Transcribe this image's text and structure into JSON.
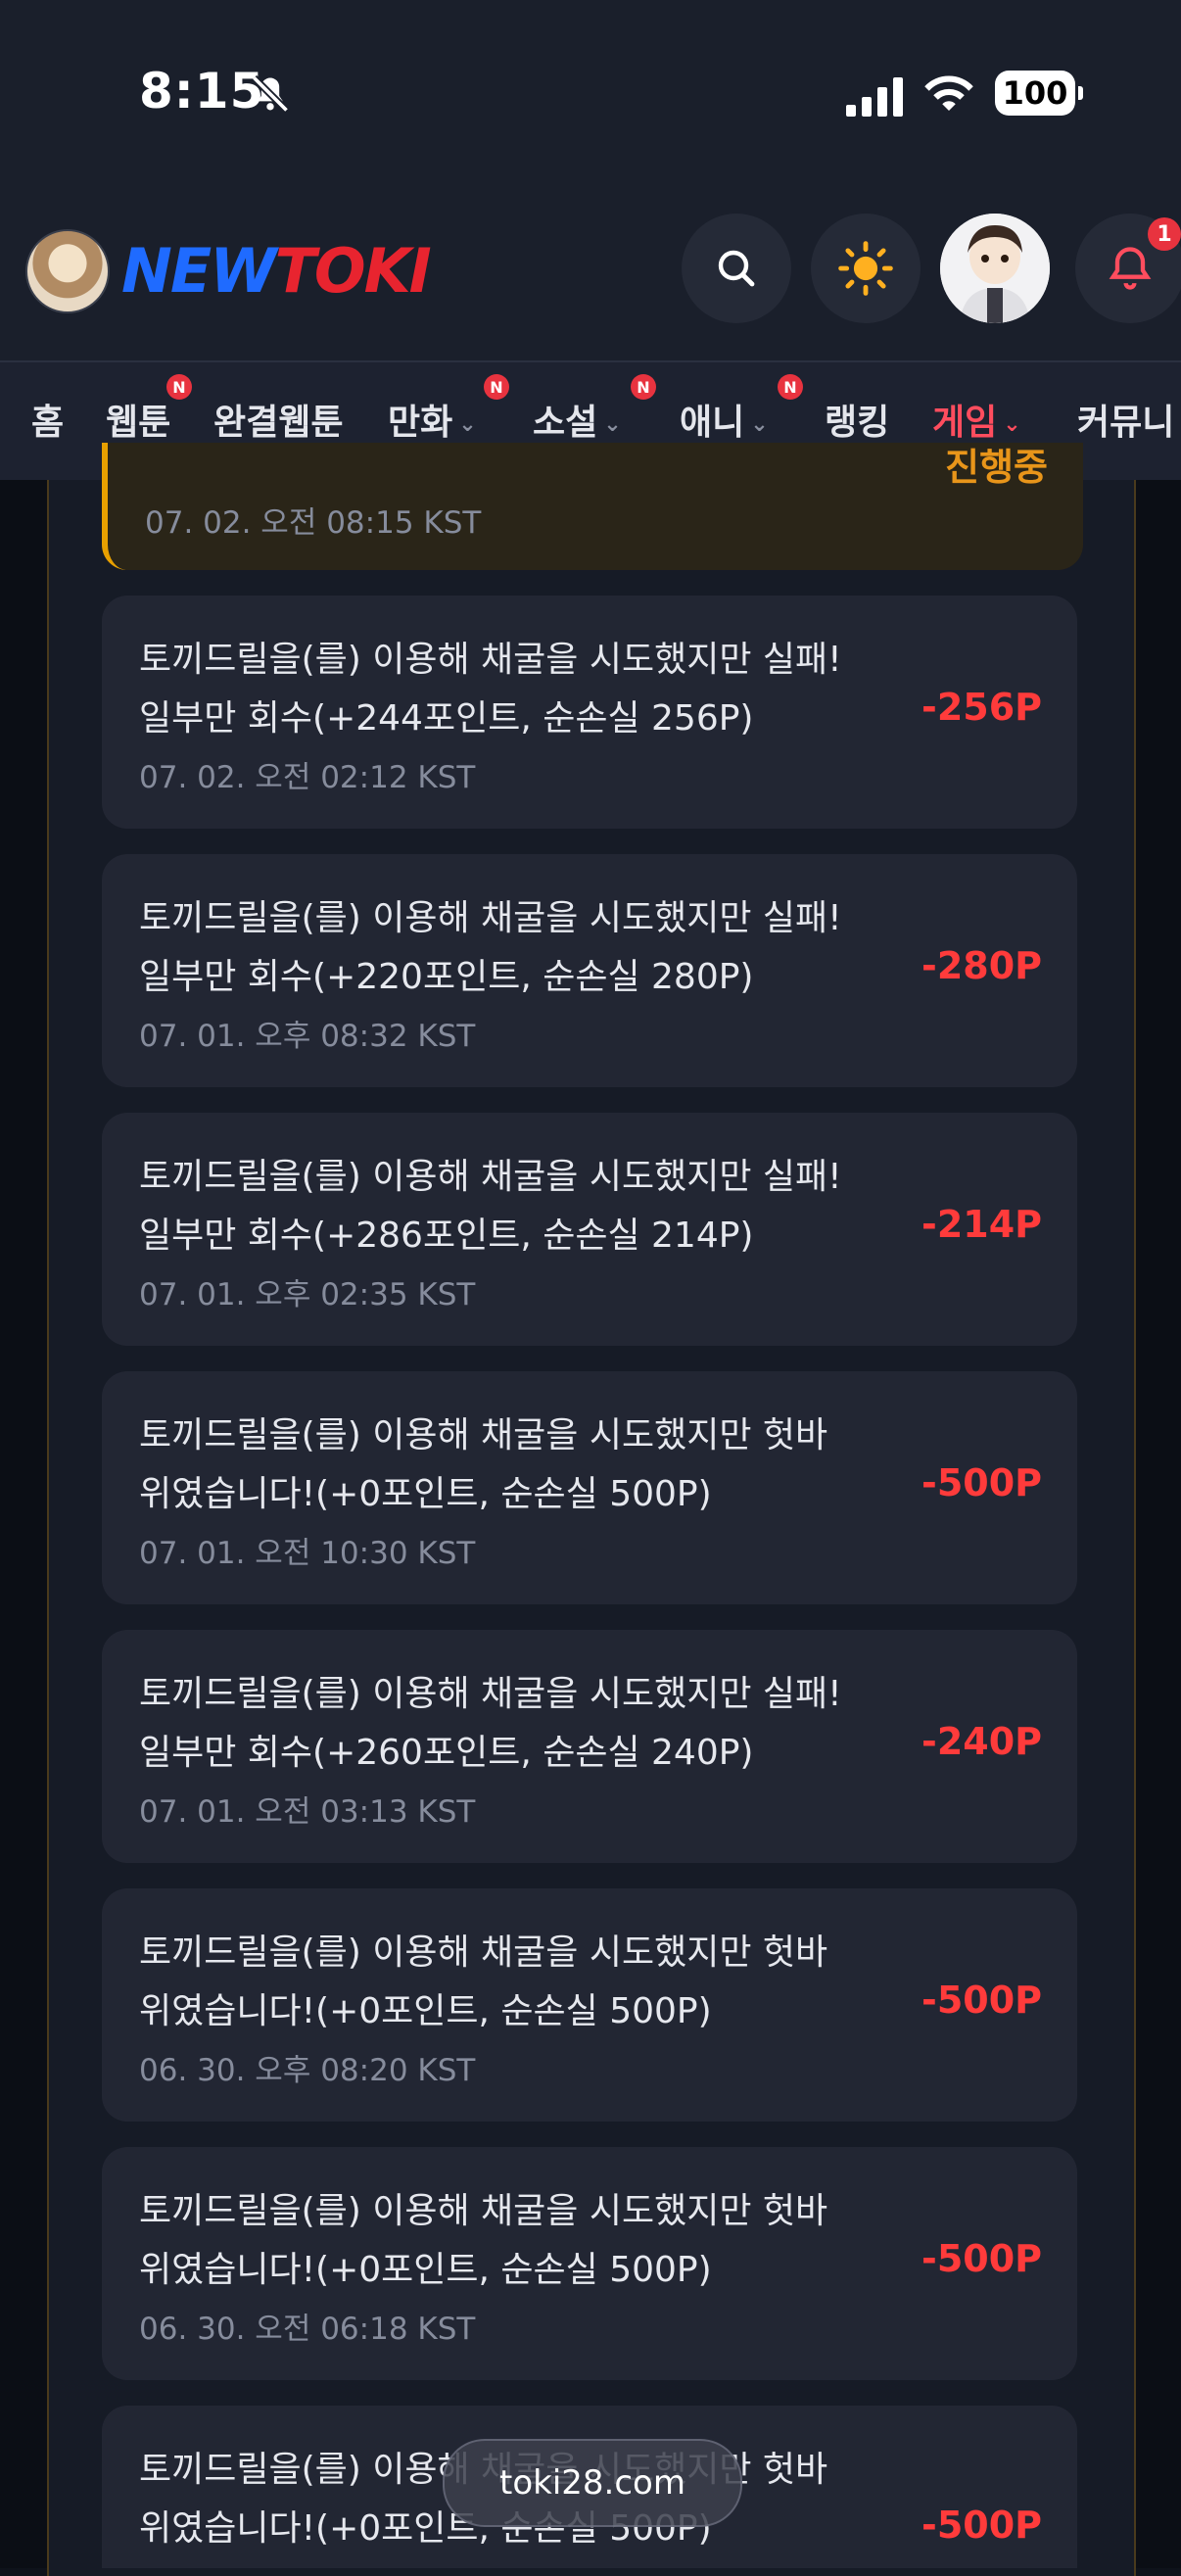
{
  "status_bar": {
    "time": "8:15",
    "battery": "100"
  },
  "header": {
    "logo_new": "NEW",
    "logo_toki": "TOKI",
    "notification_count": "1"
  },
  "nav": {
    "items": [
      {
        "label": "홈",
        "badge": ""
      },
      {
        "label": "웹툰",
        "badge": "N"
      },
      {
        "label": "완결웹툰",
        "badge": ""
      },
      {
        "label": "만화",
        "badge": "N"
      },
      {
        "label": "소설",
        "badge": "N"
      },
      {
        "label": "애니",
        "badge": "N"
      },
      {
        "label": "랭킹",
        "badge": ""
      },
      {
        "label": "게임",
        "badge": ""
      },
      {
        "label": "커뮤니",
        "badge": ""
      }
    ],
    "active": "게임"
  },
  "records": [
    {
      "line1": "",
      "line2": "",
      "date": "07. 02. 오전 08:15 KST",
      "amount": "진행중"
    },
    {
      "line1": "토끼드릴을(를) 이용해 채굴을 시도했지만 실패!",
      "line2": "일부만 회수(+244포인트, 순손실 256P)",
      "date": "07. 02. 오전 02:12 KST",
      "amount": "-256P"
    },
    {
      "line1": "토끼드릴을(를) 이용해 채굴을 시도했지만 실패!",
      "line2": "일부만 회수(+220포인트, 순손실 280P)",
      "date": "07. 01. 오후 08:32 KST",
      "amount": "-280P"
    },
    {
      "line1": "토끼드릴을(를) 이용해 채굴을 시도했지만 실패!",
      "line2": "일부만 회수(+286포인트, 순손실 214P)",
      "date": "07. 01. 오후 02:35 KST",
      "amount": "-214P"
    },
    {
      "line1": "토끼드릴을(를) 이용해 채굴을 시도했지만 헛바",
      "line2": "위였습니다!(+0포인트, 순손실 500P)",
      "date": "07. 01. 오전 10:30 KST",
      "amount": "-500P"
    },
    {
      "line1": "토끼드릴을(를) 이용해 채굴을 시도했지만 실패!",
      "line2": "일부만 회수(+260포인트, 순손실 240P)",
      "date": "07. 01. 오전 03:13 KST",
      "amount": "-240P"
    },
    {
      "line1": "토끼드릴을(를) 이용해 채굴을 시도했지만 헛바",
      "line2": "위였습니다!(+0포인트, 순손실 500P)",
      "date": "06. 30. 오후 08:20 KST",
      "amount": "-500P"
    },
    {
      "line1": "토끼드릴을(를) 이용해 채굴을 시도했지만 헛바",
      "line2": "위였습니다!(+0포인트, 순손실 500P)",
      "date": "06. 30. 오전 06:18 KST",
      "amount": "-500P"
    },
    {
      "line1": "토끼드릴을(를) 이용해 채굴을 시도했지만 헛바",
      "line2": "위였습니다!(+0포인트, 순손실 500P)",
      "date": "",
      "amount": "-500P"
    }
  ],
  "url_pill": "toki28.com",
  "colors": {
    "accent": "#ff4d5e",
    "loss": "#ff3b3b",
    "pending": "#e8951a",
    "logo_blue": "#1f6bff",
    "logo_red": "#e8242f"
  },
  "icons": [
    "bell-off-icon",
    "signal-icon",
    "wifi-icon",
    "search-icon",
    "sun-icon",
    "bell-icon",
    "chevron-down-icon"
  ]
}
